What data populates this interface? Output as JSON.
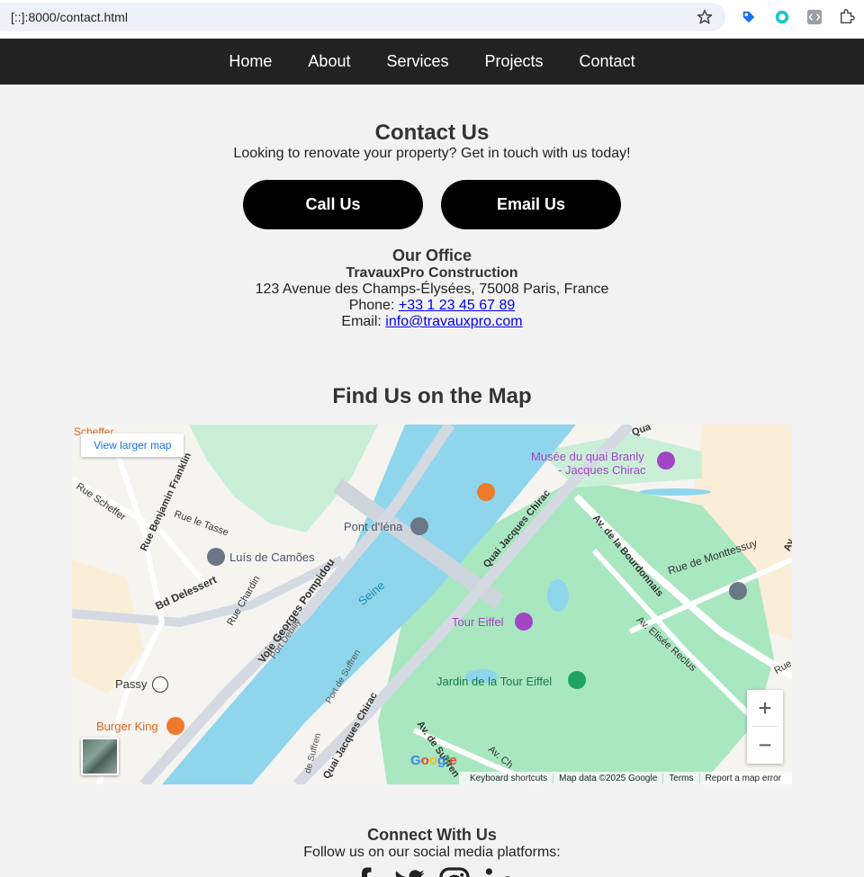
{
  "browser": {
    "url": "[::]:8000/contact.html"
  },
  "nav": {
    "items": [
      "Home",
      "About",
      "Services",
      "Projects",
      "Contact"
    ]
  },
  "contact": {
    "title": "Contact Us",
    "subtitle": "Looking to renovate your property? Get in touch with us today!",
    "call_label": "Call Us",
    "email_label": "Email Us"
  },
  "office": {
    "heading": "Our Office",
    "company": "TravauxPro Construction",
    "address": "123 Avenue des Champs-Élysées, 75008 Paris, France",
    "phone_prefix": "Phone: ",
    "phone": "+33 1 23 45 67 89",
    "email_prefix": "Email: ",
    "email": "info@travauxpro.com"
  },
  "map": {
    "title": "Find Us on the Map",
    "view_larger": "View larger map",
    "zoom_in": "+",
    "zoom_out": "−",
    "labels": {
      "musee": "Musée du quai Branly",
      "musee2": "- Jacques Chirac",
      "pont": "Pont d'Iéna",
      "luis": "Luís de Camões",
      "seine": "Seine",
      "tour": "Tour Eiffel",
      "jardin": "Jardin de la Tour Eiffel",
      "passy": "Passy",
      "burger": "Burger King",
      "bd_delessert": "Bd Delessert",
      "rue_chardin": "Rue Chardin",
      "voie": "Voie Georges Pompidou",
      "port_debilly": "Port Debilly",
      "quai_jc": "Quai Jacques Chirac",
      "quai_jc2": "Quai Jacques Chirac",
      "av_bourdonnais": "Av. de la Bourdonnais",
      "rue_monttessuy": "Rue de Monttessuy",
      "av_reclus": "Av. Elisée Reclus",
      "rue_bf": "Rue Benjamin Franklin",
      "rue_scheffer": "Rue Scheffer",
      "rue_tasse": "Rue le Tasse",
      "port_suffren": "Port de Suffren",
      "av_suffren": "Av. de Suffren",
      "scheffer": "Scheffer",
      "quai_top": "Qua",
      "av_ch": "Av. Ch",
      "rue_edge": "Rue",
      "av_edge": "Av",
      "suffren_edge": "de Suffren"
    },
    "attribution": {
      "shortcuts": "Keyboard shortcuts",
      "data": "Map data ©2025 Google",
      "terms": "Terms",
      "report": "Report a map error"
    },
    "google": "Google"
  },
  "connect": {
    "title": "Connect With Us",
    "subtitle": "Follow us on our social media platforms:"
  },
  "colors": {
    "nav_bg": "#222222",
    "page_bg": "#f2f2f2",
    "button_bg": "#000000",
    "link": "#0000ee",
    "water": "#8fd6ec",
    "park": "#b8ebcb"
  }
}
